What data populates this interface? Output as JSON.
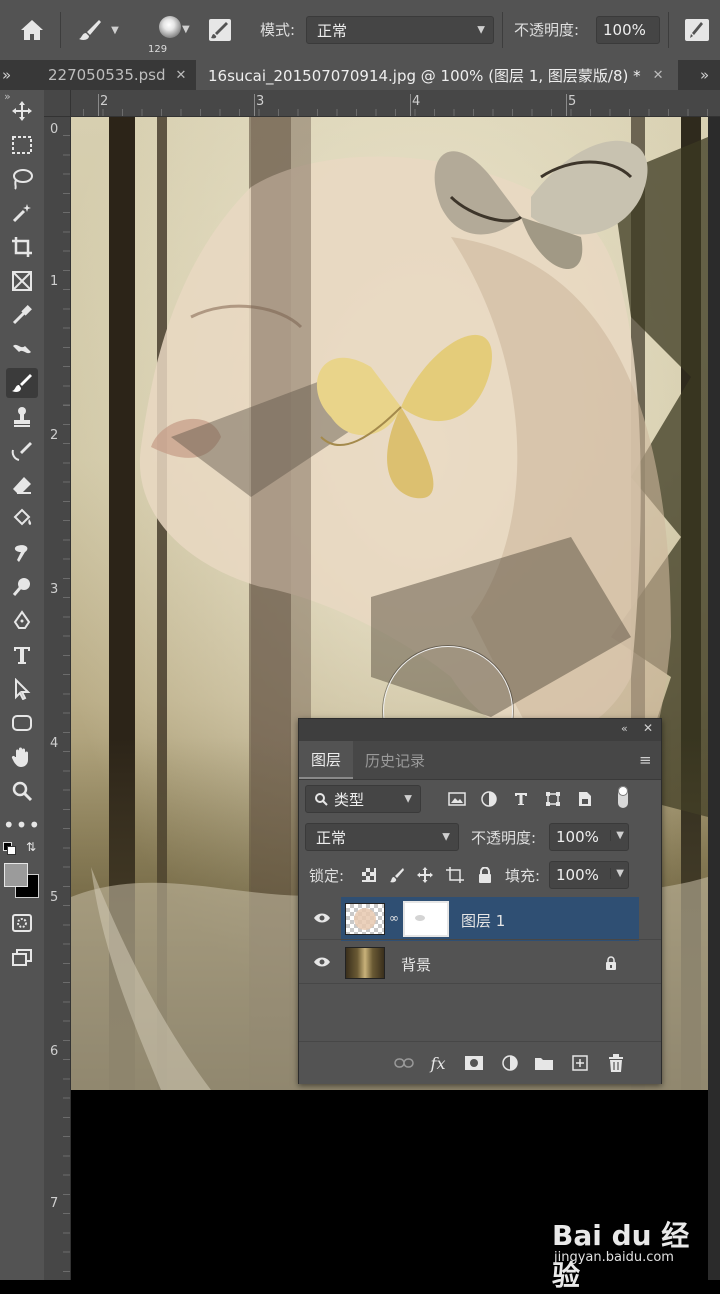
{
  "option_bar": {
    "brush_size": "129",
    "mode_label": "模式:",
    "mode_value": "正常",
    "opacity_label": "不透明度:",
    "opacity_value": "100%"
  },
  "tabs": [
    {
      "label": "227050535.psd",
      "active": false
    },
    {
      "label": "16sucai_201507070914.jpg @ 100% (图层 1, 图层蒙版/8) *",
      "active": true
    }
  ],
  "tabs_overflow": "»",
  "toolbar": {
    "tools": [
      "move-icon",
      "marquee-icon",
      "lasso-icon",
      "magic-wand-icon",
      "crop-icon",
      "frame-icon",
      "eyedropper-icon",
      "healing-icon",
      "brush-icon",
      "stamp-icon",
      "history-brush-icon",
      "eraser-icon",
      "paint-bucket-icon",
      "blur-icon",
      "dodge-icon",
      "pen-icon",
      "type-icon",
      "path-select-icon",
      "shape-icon",
      "hand-icon",
      "zoom-icon",
      "more-icon"
    ],
    "selected": "brush-icon",
    "foreground_color": "#9b9b9b",
    "background_color": "#000000"
  },
  "rulers": {
    "top": [
      "2",
      "3",
      "4",
      "5"
    ],
    "left": [
      "0",
      "1",
      "2",
      "3",
      "4",
      "5",
      "6",
      "7"
    ]
  },
  "layers_panel": {
    "tab_layers": "图层",
    "tab_history": "历史记录",
    "filter_label": "类型",
    "blend_mode": "正常",
    "opacity_label": "不透明度:",
    "opacity_value": "100%",
    "lock_label": "锁定:",
    "fill_label": "填充:",
    "fill_value": "100%",
    "layers": [
      {
        "name": "图层 1",
        "selected": true,
        "has_mask": true
      },
      {
        "name": "背景",
        "selected": false,
        "locked": true
      }
    ]
  },
  "watermark": {
    "brand": "Bai du 经验",
    "url": "jingyan.baidu.com"
  },
  "colors": {
    "selected_layer": "#2f4f73",
    "panel_bg": "#535353"
  }
}
